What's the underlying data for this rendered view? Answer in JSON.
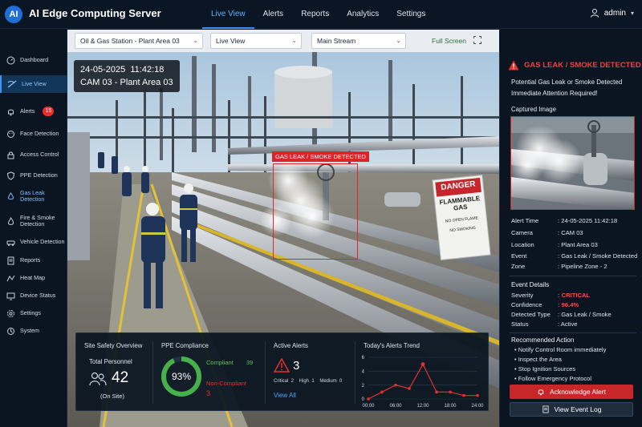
{
  "app": {
    "logo_text": "AI",
    "title": "AI Edge Computing Server"
  },
  "topnav": [
    {
      "label": "Live View",
      "active": true
    },
    {
      "label": "Alerts"
    },
    {
      "label": "Reports"
    },
    {
      "label": "Analytics"
    },
    {
      "label": "Settings"
    }
  ],
  "user": {
    "name": "admin",
    "icon": "user-icon"
  },
  "sidebar": {
    "items": [
      {
        "label": "Dashboard",
        "icon": "dashboard-icon"
      },
      {
        "label": "Live View",
        "icon": "live-view-icon",
        "active": true
      },
      {
        "label": "Alerts",
        "icon": "bell-icon",
        "badge": "15"
      },
      {
        "label": "Face Detection",
        "icon": "face-icon"
      },
      {
        "label": "Access Control",
        "icon": "lock-icon"
      },
      {
        "label": "PPE Detection",
        "icon": "shield-icon"
      },
      {
        "label": "Gas Leak Detection",
        "icon": "gas-drop-icon",
        "highlight": true
      },
      {
        "label": "Fire & Smoke Detection",
        "icon": "fire-icon"
      },
      {
        "label": "Vehicle Detection",
        "icon": "vehicle-icon"
      },
      {
        "label": "Reports",
        "icon": "report-icon"
      },
      {
        "label": "Heat Map",
        "icon": "heat-map-icon"
      },
      {
        "label": "Device Status",
        "icon": "device-icon"
      },
      {
        "label": "Settings",
        "icon": "gear-icon"
      },
      {
        "label": "System",
        "icon": "system-icon"
      }
    ]
  },
  "filters": {
    "site": "Oil & Gas Station - Plant Area 03",
    "view": "Live View",
    "stream": "Main Stream",
    "fullscreen_label": "Full Screen"
  },
  "video": {
    "timestamp": "24-05-2025  11:42:18",
    "camera_label": "CAM 03 - Plant Area 03",
    "detection_label": "GAS LEAK / SMOKE DETECTED",
    "sign_title": "DANGER",
    "sign_line1": "FLAMMABLE",
    "sign_line2": "GAS",
    "sign_line3": "NO OPEN FLAME",
    "sign_line4": "NO SMOKING"
  },
  "stats": {
    "safety": {
      "title": "Site Safety Overview",
      "personnel_label": "Total Personnel",
      "personnel_count": "42",
      "personnel_sub": "(On Site)"
    },
    "ppe": {
      "title": "PPE Compliance",
      "percent": 93,
      "percent_text": "93%",
      "compliant_label": "Compliant",
      "compliant_count": "39",
      "noncompliant_label": "Non-Compliant",
      "noncompliant_count": "3"
    },
    "alerts": {
      "title": "Active Alerts",
      "count": "3",
      "breakdown": "Critical  2    High  1    Medium  0",
      "view_all": "View All"
    },
    "trend": {
      "title": "Today's Alerts Trend"
    }
  },
  "chart_data": {
    "type": "line",
    "title": "Today's Alerts Trend",
    "x": [
      "00:00",
      "03:00",
      "06:00",
      "09:00",
      "12:00",
      "15:00",
      "18:00",
      "21:00",
      "24:00"
    ],
    "values": [
      0,
      1,
      2,
      1.5,
      5,
      1,
      1,
      0.5,
      0.5
    ],
    "ylim": [
      0,
      6
    ],
    "yticks": [
      0,
      2,
      4,
      6
    ],
    "xtick_labels": [
      "00:00",
      "06:00",
      "12:00",
      "18:00",
      "24:00"
    ],
    "color": "#e5312c",
    "grid": true
  },
  "alert_panel": {
    "title": "GAS LEAK / SMOKE DETECTED",
    "message1": "Potential Gas Leak or Smoke Detected",
    "message2": "Immediate Attention Required!",
    "captured_label": "Captured Image",
    "details": [
      {
        "key": "Alert Time",
        "value": ": 24-05-2025 11:42:18"
      },
      {
        "key": "Camera",
        "value": ": CAM 03"
      },
      {
        "key": "Location",
        "value": ": Plant Area 03"
      },
      {
        "key": "Event",
        "value": ": Gas Leak / Smoke Detected"
      },
      {
        "key": "Zone",
        "value": ": Pipeline Zone - 2"
      }
    ],
    "event_details_title": "Event Details",
    "event_details": [
      {
        "key": "Severity",
        "value": ": CRITICAL",
        "red": true
      },
      {
        "key": "Confidence",
        "value": ": 96.4%",
        "red": true
      },
      {
        "key": "Detected Type",
        "value": ": Gas Leak / Smoke"
      },
      {
        "key": "Status",
        "value": ": Active"
      }
    ],
    "recommended_title": "Recommended Action",
    "actions": [
      "• Notify Control Room immediately",
      "• Inspect the Area",
      "• Stop Ignition Sources",
      "• Follow Emergency Protocol"
    ],
    "acknowledge_label": "Acknowledge Alert",
    "event_log_label": "View Event Log"
  },
  "colors": {
    "accent": "#3f95ef",
    "danger": "#e5312c",
    "success": "#3cb043",
    "bg": "#0a1320"
  }
}
